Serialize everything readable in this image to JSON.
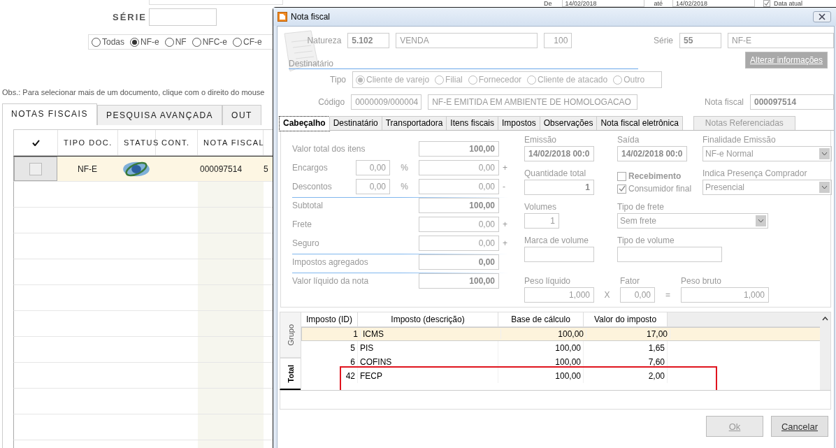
{
  "background": {
    "date_filter": {
      "from_label": "De",
      "from": "14/02/2018",
      "to_label": "até",
      "to": "14/02/2018",
      "today": {
        "label": "Data atual",
        "checked": true
      }
    },
    "serie": {
      "label": "SÉRIE"
    },
    "doc_types": [
      {
        "label": "Todas",
        "selected": false
      },
      {
        "label": "NF-e",
        "selected": true
      },
      {
        "label": "NF",
        "selected": false
      },
      {
        "label": "NFC-e",
        "selected": false
      },
      {
        "label": "CF-e",
        "selected": false
      }
    ],
    "note": "Obs.: Para selecionar mais de um documento, clique com o direito do mouse",
    "tabs": [
      {
        "label": "NOTAS FISCAIS",
        "selected": true
      },
      {
        "label": "PESQUISA AVANÇADA",
        "selected": false
      },
      {
        "label": "OUT",
        "selected": false
      }
    ],
    "table": {
      "columns": [
        "TIPO DOC.",
        "STATUS",
        "CONT.",
        "NOTA FISCAL"
      ],
      "rows": [
        {
          "checked": false,
          "selected": true,
          "tipo_doc": "NF-E",
          "nota_fiscal": "000097514",
          "column_6": "5"
        }
      ]
    }
  },
  "dialog": {
    "title": "Nota fiscal",
    "natureza": {
      "label": "Natureza",
      "code": "5.102",
      "description": "VENDA",
      "number": "100"
    },
    "serie": {
      "label": "Série",
      "number": "55",
      "model": "NF-E"
    },
    "destinatario": {
      "label": "Destinatário",
      "button": {
        "label": "Alterar informações",
        "disabled": true
      }
    },
    "tipo": {
      "label": "Tipo",
      "options": [
        {
          "label": "Cliente de varejo",
          "selected": true
        },
        {
          "label": "Filial",
          "selected": false
        },
        {
          "label": "Fornecedor",
          "selected": false
        },
        {
          "label": "Cliente de atacado",
          "selected": false
        },
        {
          "label": "Outro",
          "selected": false
        }
      ]
    },
    "codigo": {
      "label": "Código",
      "code": "0000009/000004",
      "name": "NF-E EMITIDA EM AMBIENTE DE HOMOLOGACAO"
    },
    "nota_fiscal": {
      "label": "Nota fiscal",
      "value": "000097514"
    },
    "tabs": [
      {
        "label": "Cabeçalho",
        "selected": true,
        "disabled": false
      },
      {
        "label": "Destinatário",
        "selected": false,
        "disabled": false
      },
      {
        "label": "Transportadora",
        "selected": false,
        "disabled": false
      },
      {
        "label": "Itens fiscais",
        "selected": false,
        "disabled": false
      },
      {
        "label": "Impostos",
        "selected": false,
        "disabled": false
      },
      {
        "label": "Observações",
        "selected": false,
        "disabled": false
      },
      {
        "label": "Nota fiscal eletrônica",
        "selected": false,
        "disabled": false
      },
      {
        "label": "Notas Referenciadas",
        "selected": false,
        "disabled": true
      }
    ],
    "totals": [
      {
        "kind": "total",
        "label": "Valor total dos itens",
        "value": "100,00"
      },
      {
        "kind": "percent",
        "label": "Encargos",
        "percent": "0,00",
        "unit": "%",
        "value": "0,00",
        "operator": "+"
      },
      {
        "kind": "percent",
        "label": "Descontos",
        "percent": "0,00",
        "unit": "%",
        "value": "0,00",
        "operator": "-"
      },
      {
        "kind": "separator"
      },
      {
        "kind": "total",
        "label": "Subtotal",
        "value": "100,00"
      },
      {
        "kind": "amount",
        "label": "Frete",
        "value": "0,00",
        "operator": "+"
      },
      {
        "kind": "amount",
        "label": "Seguro",
        "value": "0,00",
        "operator": "+"
      },
      {
        "kind": "separator"
      },
      {
        "kind": "total",
        "label": "Impostos agregados",
        "value": "0,00"
      },
      {
        "kind": "separator"
      },
      {
        "kind": "total",
        "label": "Valor líquido da nota",
        "value": "100,00"
      }
    ],
    "emissao": {
      "label": "Emissão",
      "value": "14/02/2018 00:0"
    },
    "saida": {
      "label": "Saída",
      "value": "14/02/2018 00:0"
    },
    "finalidade": {
      "label": "Finalidade Emissão",
      "value": "NF-e Normal"
    },
    "quantidade": {
      "label": "Quantidade total",
      "value": "1"
    },
    "recebimento": {
      "label": "Recebimento",
      "checked": false
    },
    "consumidor_final": {
      "label": "Consumidor final",
      "checked": true
    },
    "presenca": {
      "label": "Indica Presença Comprador",
      "value": "Presencial"
    },
    "volumes": {
      "label": "Volumes",
      "value": "1"
    },
    "tipo_frete": {
      "label": "Tipo de frete",
      "value": "Sem frete"
    },
    "marca_volume": {
      "label": "Marca de volume"
    },
    "tipo_volume": {
      "label": "Tipo de volume"
    },
    "peso_liquido": {
      "label": "Peso líquido",
      "value": "1,000"
    },
    "times": "X",
    "fator": {
      "label": "Fator",
      "value": "0,00"
    },
    "equals": "=",
    "peso_bruto": {
      "label": "Peso bruto",
      "value": "1,000"
    },
    "side_tabs": [
      {
        "label": "Grupo",
        "selected": false
      },
      {
        "label": "Total",
        "selected": true
      }
    ],
    "taxes": {
      "columns": [
        "Imposto (ID)",
        "Imposto (descrição)",
        "Base de cálculo",
        "Valor do imposto"
      ],
      "rows": [
        {
          "id": "1",
          "description": "ICMS",
          "base": "100,00",
          "value": "17,00",
          "selected": true,
          "highlighted": false
        },
        {
          "id": "5",
          "description": "PIS",
          "base": "100,00",
          "value": "1,65",
          "selected": false,
          "highlighted": false
        },
        {
          "id": "6",
          "description": "COFINS",
          "base": "100,00",
          "value": "7,60",
          "selected": false,
          "highlighted": false
        },
        {
          "id": "42",
          "description": "FECP",
          "base": "100,00",
          "value": "2,00",
          "selected": false,
          "highlighted": true
        }
      ]
    },
    "buttons": [
      {
        "label": "Ok",
        "disabled": true
      },
      {
        "label": "Cancelar",
        "disabled": false
      }
    ]
  }
}
